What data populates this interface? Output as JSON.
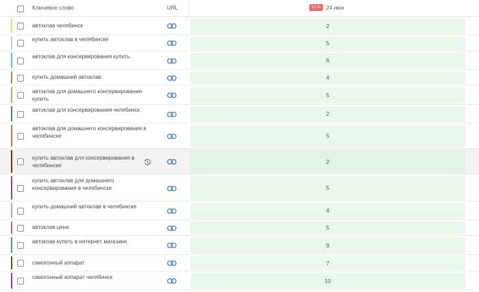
{
  "header": {
    "keyword_label": "Ключевое слово",
    "url_label": "URL",
    "badge": "12 %",
    "date": "24 июн"
  },
  "rows": [
    {
      "keyword": "автоклав челябинск",
      "position": "2",
      "color": "#e9e33a"
    },
    {
      "keyword": "купить автоклав в челябинске",
      "position": "5",
      "color": "#c9c9c9"
    },
    {
      "keyword": "автоклав для консервирования купить",
      "position": "6",
      "color": "#53c0c9"
    },
    {
      "keyword": "купить домашний автоклав",
      "position": "4",
      "color": "#b0862c"
    },
    {
      "keyword": "автоклав для домашнего консервирования купить",
      "position": "5",
      "color": "#d6a347"
    },
    {
      "keyword": "автоклав для консервирования челябинск",
      "position": "2",
      "color": "#4d67c9"
    },
    {
      "keyword": "автоклав для домашнего консервирования в челябинске",
      "position": "5",
      "color": "#c9771f"
    },
    {
      "keyword": "купить автоклав для консервирования в челябинске",
      "position": "2",
      "color": "#8f1a1a",
      "highlighted": true
    },
    {
      "keyword": "купить автоклав для домашнего консервирования в челябинске",
      "position": "5",
      "color": "#8e3fb0"
    },
    {
      "keyword": "купить домашний автоклав в челябинске",
      "position": "4",
      "color": "#d98fd0"
    },
    {
      "keyword": "автоклав цена",
      "position": "5",
      "color": "#e0536e"
    },
    {
      "keyword": "автоклав купить в интернет магазине",
      "position": "9",
      "color": "#3a9b9b"
    },
    {
      "keyword": "самогонный аппарат",
      "position": "7",
      "color": "#6a4a2a"
    },
    {
      "keyword": "самогонный аппарат челябинск",
      "position": "10",
      "color": "#a12cb5"
    }
  ],
  "icons": {
    "row_checkbox": "checkbox-icon",
    "url": "link-icon",
    "history": "history-icon"
  },
  "colors": {
    "cell_bg": "#eaf7ed",
    "badge_bg": "#e86a6a",
    "link_icon": "#4a86c5"
  }
}
